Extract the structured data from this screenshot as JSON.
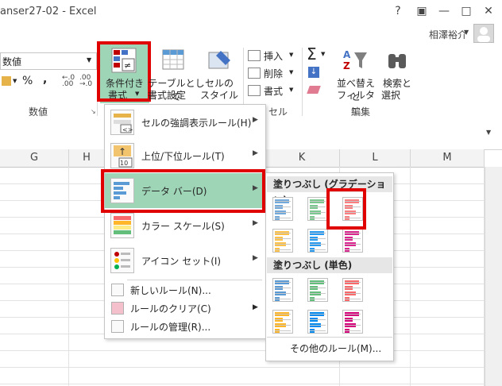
{
  "window": {
    "title": "anser27-02 - Excel",
    "help": "?",
    "restore_ribbon": "▣",
    "minimize": "—",
    "maximize": "□",
    "close": "✕"
  },
  "account": {
    "user_name": "相澤裕介"
  },
  "ribbon": {
    "number_format_value": "数値",
    "number_group_label": "数値",
    "percent": "%",
    "comma": ",",
    "cond_format": {
      "line1": "条件付き",
      "line2": "書式"
    },
    "format_as_table": {
      "line1": "テーブルとして",
      "line2": "書式設定"
    },
    "cell_styles": {
      "line1": "セルの",
      "line2": "スタイル"
    },
    "insert": "挿入",
    "delete": "削除",
    "format": "書式",
    "cells_group_label": "セル",
    "sort_filter": {
      "line1": "並べ替えと",
      "line2": "フィルター"
    },
    "find_select": {
      "line1": "検索と",
      "line2": "選択"
    },
    "editing_group_label": "編集"
  },
  "columns": [
    "G",
    "H",
    "K",
    "L",
    "M"
  ],
  "menu": {
    "items": [
      {
        "label": "セルの強調表示ルール(H)",
        "icon": "highlight-rules-icon"
      },
      {
        "label": "上位/下位ルール(T)",
        "icon": "top-bottom-rules-icon"
      },
      {
        "label": "データ バー(D)",
        "icon": "data-bars-icon"
      },
      {
        "label": "カラー スケール(S)",
        "icon": "color-scales-icon"
      },
      {
        "label": "アイコン セット(I)",
        "icon": "icon-sets-icon"
      }
    ],
    "small_items": [
      {
        "label": "新しいルール(N)..."
      },
      {
        "label": "ルールのクリア(C)"
      },
      {
        "label": "ルールの管理(R)..."
      }
    ]
  },
  "submenu": {
    "gradient_header": "塗りつぶし (グラデーション)",
    "solid_header": "塗りつぶし (単色)",
    "more_rules": "その他のルール(M)...",
    "bar_colors": [
      "#5b9bd5",
      "#63be7b",
      "#f8696b",
      "#ffb628",
      "#008aef",
      "#d6007b"
    ]
  },
  "colors": {
    "highlight_green": "#9fd5b7",
    "red_outline": "#e00000"
  }
}
